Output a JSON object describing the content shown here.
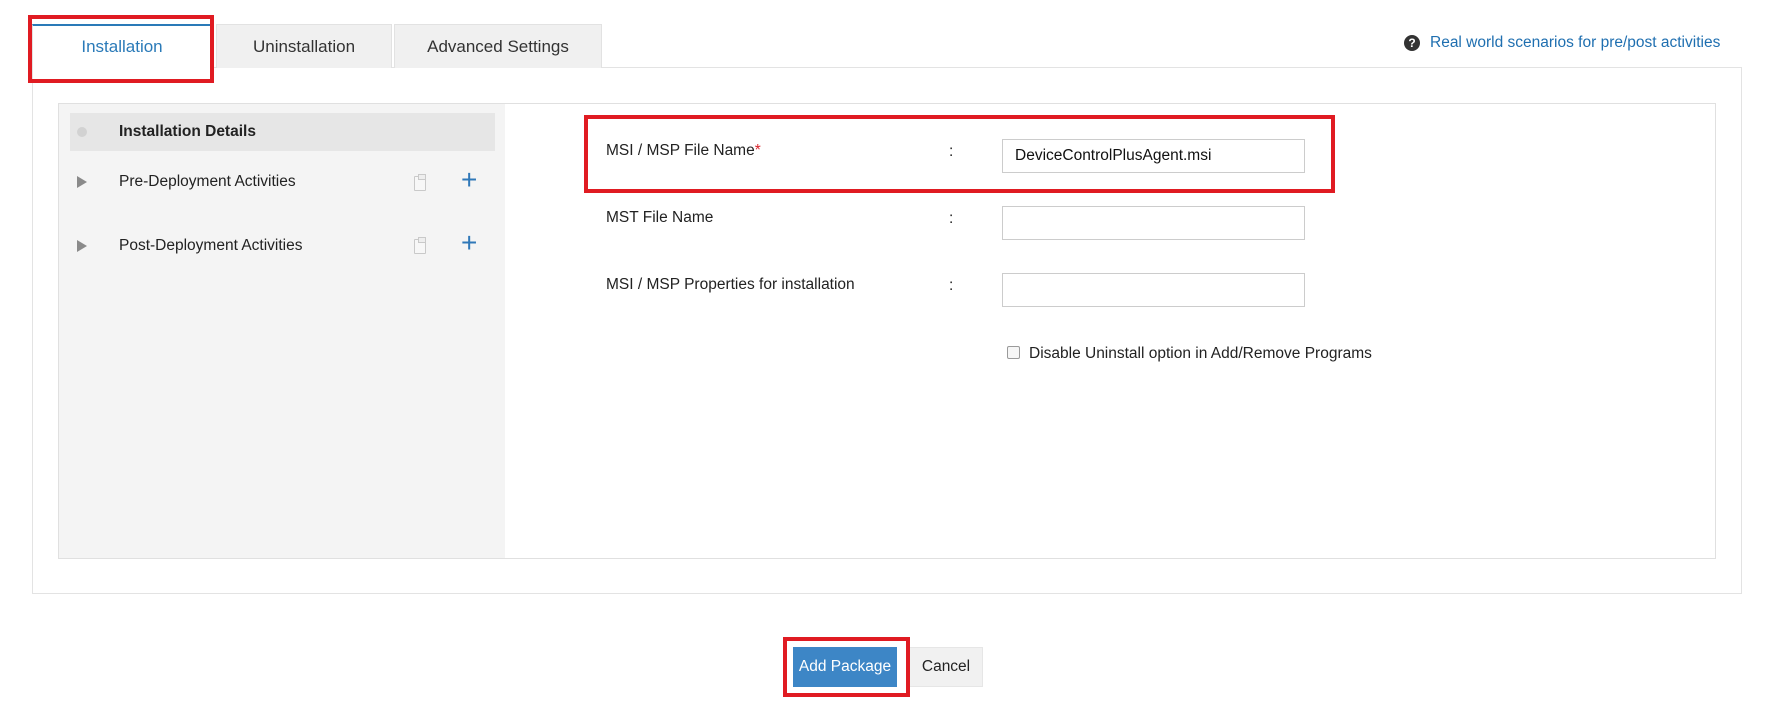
{
  "tabs": [
    {
      "label": "Installation",
      "active": true
    },
    {
      "label": "Uninstallation",
      "active": false
    },
    {
      "label": "Advanced Settings",
      "active": false
    }
  ],
  "help_link": {
    "label": "Real world scenarios for pre/post activities",
    "icon": "question-circle-icon"
  },
  "sidebar": {
    "items": [
      {
        "label": "Installation Details",
        "icon": "dot-icon"
      },
      {
        "label": "Pre-Deployment Activities",
        "icon": "expand-arrow-icon"
      },
      {
        "label": "Post-Deployment Activities",
        "icon": "expand-arrow-icon"
      }
    ]
  },
  "form": {
    "msi_label": "MSI / MSP File Name",
    "required_mark": "*",
    "colon": ":",
    "msi_value": "DeviceControlPlusAgent.msi",
    "mst_label": "MST File Name",
    "mst_value": "",
    "props_label": "MSI / MSP Properties for installation",
    "props_value": "",
    "disable_uninstall_label": "Disable Uninstall option in Add/Remove Programs",
    "disable_uninstall_checked": false
  },
  "actions": {
    "add_label": "Add Package",
    "cancel_label": "Cancel"
  },
  "colors": {
    "accent": "#2a7ab8",
    "primary_button": "#3d86c6",
    "highlight": "#e01b22",
    "required": "#d9222a"
  }
}
